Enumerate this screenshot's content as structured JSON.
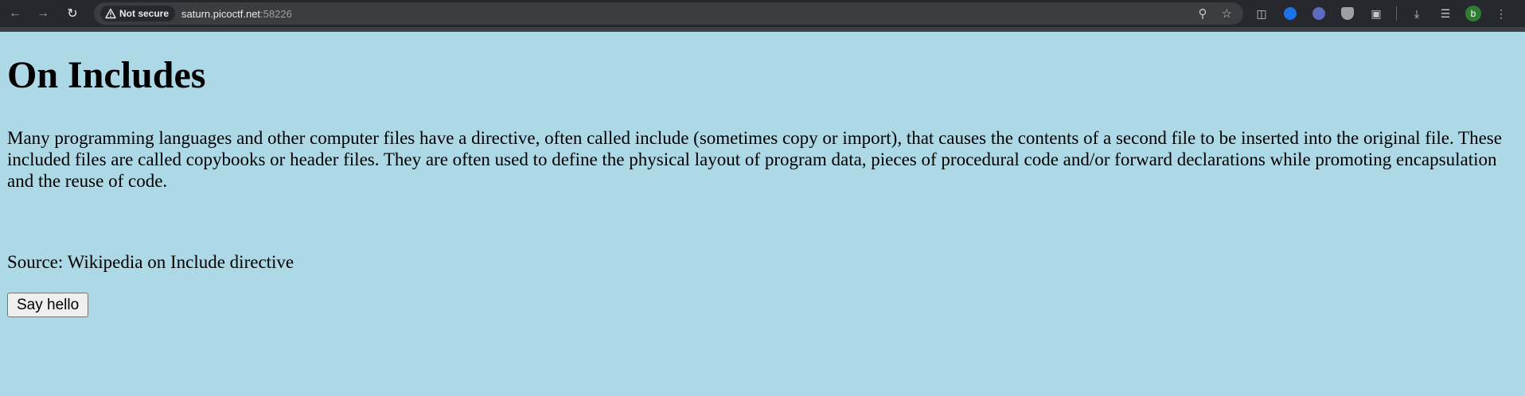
{
  "browser": {
    "security_label": "Not secure",
    "url_host": "saturn.picoctf.net",
    "url_port": ":58226",
    "profile_initial": "b"
  },
  "page": {
    "background": "#add8e6",
    "heading": "On Includes",
    "paragraph": "Many programming languages and other computer files have a directive, often called include (sometimes copy or import), that causes the contents of a second file to be inserted into the original file. These included files are called copybooks or header files. They are often used to define the physical layout of program data, pieces of procedural code and/or forward declarations while promoting encapsulation and the reuse of code.",
    "source": "Source: Wikipedia on Include directive",
    "button_label": "Say hello"
  },
  "icons": [
    "back-icon",
    "forward-icon",
    "reload-icon",
    "warning-icon",
    "zoom-icon",
    "star-icon",
    "extension-icon",
    "download-icon",
    "media-icon",
    "menu-icon"
  ]
}
